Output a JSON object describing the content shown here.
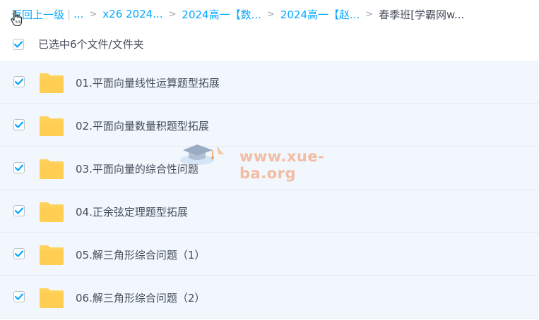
{
  "breadcrumb": {
    "back": "返回上一级",
    "pipe": "|",
    "ellipsis": "...",
    "items": [
      "x26 2024...",
      "2024高一【数...",
      "2024高一【赵..."
    ],
    "current": "春季班[学霸网w...",
    "separator": ">"
  },
  "selection": {
    "label": "已选中6个文件/文件夹",
    "checked": true
  },
  "files": [
    {
      "name": "01.平面向量线性运算题型拓展",
      "checked": true,
      "icon": "folder-icon"
    },
    {
      "name": "02.平面向量数量积题型拓展",
      "checked": true,
      "icon": "folder-icon"
    },
    {
      "name": "03.平面向量的综合性问题",
      "checked": true,
      "icon": "folder-icon"
    },
    {
      "name": "04.正余弦定理题型拓展",
      "checked": true,
      "icon": "folder-icon"
    },
    {
      "name": "05.解三角形综合问题（1）",
      "checked": true,
      "icon": "folder-icon"
    },
    {
      "name": "06.解三角形综合问题（2）",
      "checked": true,
      "icon": "folder-icon"
    }
  ],
  "watermark": {
    "text": "www.xue-ba.org"
  },
  "colors": {
    "link": "#06a7ff",
    "check": "#06a7ff",
    "folder": "#ffd25c",
    "row_bg": "#f1f7fd",
    "text": "#454d5a"
  }
}
